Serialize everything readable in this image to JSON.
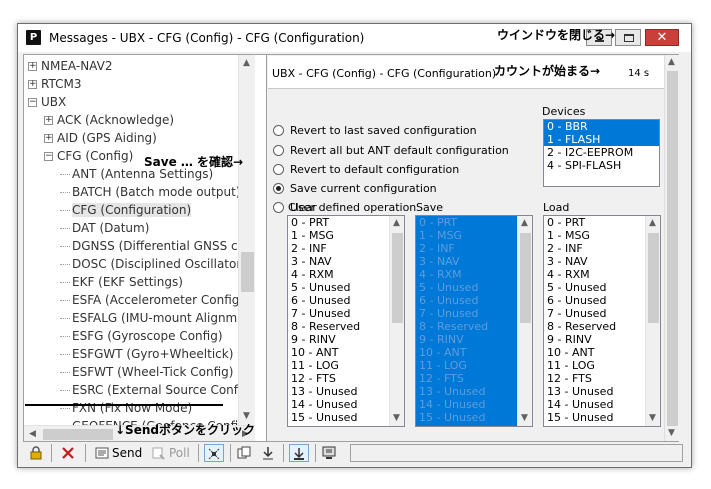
{
  "window": {
    "title": "Messages - UBX - CFG (Config) - CFG (Configuration)",
    "app_icon_letter": "P",
    "close_glyph": "✕"
  },
  "annotations": {
    "close_window": "ウインドウを閉じる→",
    "countdown_start": "カウントが始まる→",
    "confirm_save": "Save … を確認→",
    "click_send": "↓Sendボタンをクリック"
  },
  "tree": {
    "items": [
      {
        "label": "NMEA-NAV2",
        "indent": 0,
        "expander": "+"
      },
      {
        "label": "RTCM3",
        "indent": 0,
        "expander": "+"
      },
      {
        "label": "UBX",
        "indent": 0,
        "expander": "−"
      },
      {
        "label": "ACK (Acknowledge)",
        "indent": 1,
        "expander": "+"
      },
      {
        "label": "AID (GPS Aiding)",
        "indent": 1,
        "expander": "+"
      },
      {
        "label": "CFG (Config)",
        "indent": 1,
        "expander": "−"
      },
      {
        "label": "ANT (Antenna Settings)",
        "indent": 2,
        "expander": ""
      },
      {
        "label": "BATCH (Batch mode output)",
        "indent": 2,
        "expander": ""
      },
      {
        "label": "CFG (Configuration)",
        "indent": 2,
        "expander": "",
        "selected": true
      },
      {
        "label": "DAT (Datum)",
        "indent": 2,
        "expander": ""
      },
      {
        "label": "DGNSS (Differential GNSS co",
        "indent": 2,
        "expander": ""
      },
      {
        "label": "DOSC (Disciplined Oscillator",
        "indent": 2,
        "expander": ""
      },
      {
        "label": "EKF (EKF Settings)",
        "indent": 2,
        "expander": ""
      },
      {
        "label": "ESFA (Accelerometer Config",
        "indent": 2,
        "expander": ""
      },
      {
        "label": "ESFALG (IMU-mount Alignm",
        "indent": 2,
        "expander": ""
      },
      {
        "label": "ESFG (Gyroscope Config)",
        "indent": 2,
        "expander": ""
      },
      {
        "label": "ESFGWT (Gyro+Wheeltick)",
        "indent": 2,
        "expander": ""
      },
      {
        "label": "ESFWT (Wheel-Tick Config)",
        "indent": 2,
        "expander": ""
      },
      {
        "label": "ESRC (External Source Confic",
        "indent": 2,
        "expander": ""
      },
      {
        "label": "FXN (Fix Now Mode)",
        "indent": 2,
        "expander": ""
      },
      {
        "label": "GEOFENCE (Geofence Config",
        "indent": 2,
        "expander": ""
      }
    ]
  },
  "panel": {
    "title": "UBX - CFG (Config) - CFG (Configuration)",
    "countdown": "14 s",
    "radios": [
      {
        "label": "Revert to last saved configuration",
        "checked": false
      },
      {
        "label": "Revert all but ANT default configuration",
        "checked": false
      },
      {
        "label": "Revert to default configuration",
        "checked": false
      },
      {
        "label": "Save current configuration",
        "checked": true
      },
      {
        "label": "User defined operation",
        "checked": false
      }
    ],
    "devices_label": "Devices",
    "devices": [
      {
        "label": "0 - BBR",
        "selected": true
      },
      {
        "label": "1 - FLASH",
        "selected": true
      },
      {
        "label": "2 - I2C-EEPROM",
        "selected": false
      },
      {
        "label": "4 - SPI-FLASH",
        "selected": false
      }
    ],
    "clear_label": "Clear",
    "save_label": "Save",
    "load_label": "Load",
    "sections": [
      "0 - PRT",
      "1 - MSG",
      "2 - INF",
      "3 - NAV",
      "4 - RXM",
      "5 - Unused",
      "6 - Unused",
      "7 - Unused",
      "8 - Reserved",
      "9 - RINV",
      "10 - ANT",
      "11 - LOG",
      "12 - FTS",
      "13 - Unused",
      "14 - Unused",
      "15 - Unused"
    ]
  },
  "toolbar": {
    "send_label": "Send",
    "poll_label": "Poll"
  }
}
